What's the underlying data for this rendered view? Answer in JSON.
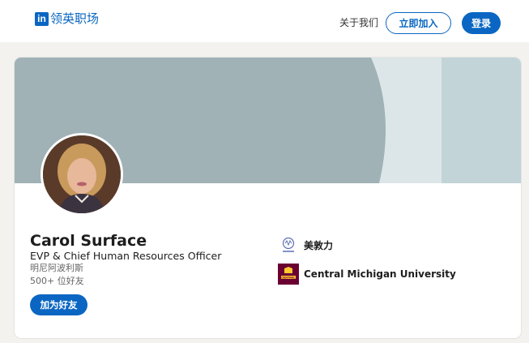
{
  "header": {
    "logo_badge": "in",
    "logo_text": "领英职场",
    "about_link": "关于我们",
    "join_button": "立即加入",
    "login_button": "登录"
  },
  "profile": {
    "name": "Carol Surface",
    "headline": "EVP & Chief Human Resources Officer",
    "location": "明尼阿波利斯",
    "connections": "500+ 位好友",
    "connect_button": "加为好友"
  },
  "organizations": [
    {
      "name": "美敦力",
      "icon": "medtronic-logo"
    },
    {
      "name": "Central Michigan University",
      "icon": "cmu-logo",
      "logo_text": "CENTRAL"
    }
  ],
  "colors": {
    "brand": "#0a66c2",
    "banner_main": "#a0b2b6",
    "banner_mid": "#dce6e8",
    "banner_right": "#c2d4d7",
    "cmu_maroon": "#6a0032",
    "cmu_gold": "#ffc82e"
  }
}
